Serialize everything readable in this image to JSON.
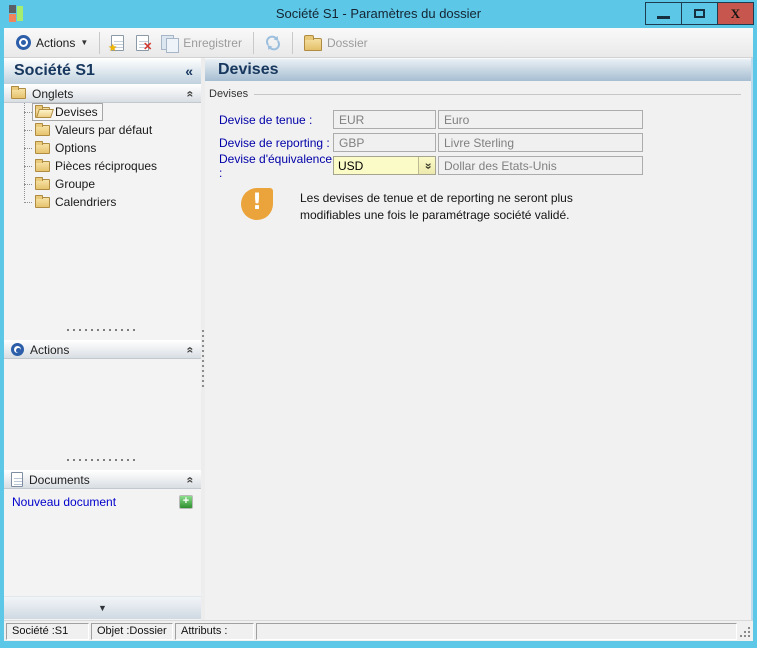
{
  "window": {
    "title": "Société S1 -  Paramètres du dossier"
  },
  "toolbar": {
    "actions_label": "Actions",
    "save_label": "Enregistrer",
    "dossier_label": "Dossier"
  },
  "sidebar": {
    "title": "Société S1",
    "sections": {
      "onglets": "Onglets",
      "actions": "Actions",
      "documents": "Documents"
    },
    "tree_items": [
      {
        "label": "Devises",
        "selected": true
      },
      {
        "label": "Valeurs par défaut",
        "selected": false
      },
      {
        "label": "Options",
        "selected": false
      },
      {
        "label": "Pièces réciproques",
        "selected": false
      },
      {
        "label": "Groupe",
        "selected": false
      },
      {
        "label": "Calendriers",
        "selected": false
      }
    ],
    "new_document_label": "Nouveau document"
  },
  "main": {
    "header": "Devises",
    "group_label": "Devises",
    "fields": [
      {
        "label": "Devise de tenue :",
        "code": "EUR",
        "name": "Euro"
      },
      {
        "label": "Devise de reporting :",
        "code": "GBP",
        "name": "Livre Sterling"
      },
      {
        "label": "Devise d'équivalence :",
        "code": "USD",
        "name": "Dollar des Etats-Unis"
      }
    ],
    "warning_text": "Les devises de tenue et de reporting ne seront plus modifiables une fois le paramétrage société validé."
  },
  "status": {
    "company": "Société :S1",
    "object": "Objet :Dossier",
    "attributes": "Attributs :"
  },
  "icons": {
    "collapse_left": "«",
    "collapse_up": "«",
    "combo_down": "«",
    "menu_down": "▼",
    "scroll_down": "▼",
    "close": "X",
    "star": "★",
    "delete_x": "✕",
    "plus": "+",
    "warning_exclamation": "!"
  },
  "colors": {
    "titlebar": "#5CC7E6",
    "close_button": "#C7574E",
    "header_text": "#17375E",
    "label_blue": "#0000A8",
    "combo_bg": "#FBFBC8",
    "warning_icon": "#EBA43B",
    "link": "#0000CC",
    "plus_green": "#3DA53D"
  }
}
